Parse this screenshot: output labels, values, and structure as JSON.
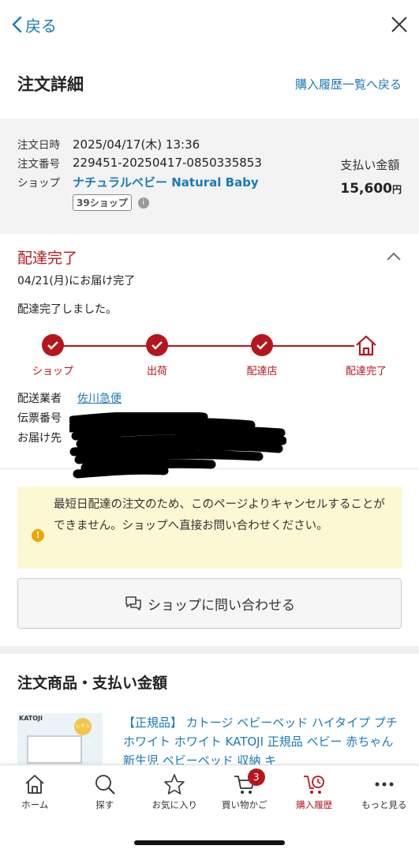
{
  "nav": {
    "back_label": "戻る"
  },
  "header": {
    "title": "注文詳細",
    "history_link": "購入履歴一覧へ戻る"
  },
  "order": {
    "date_label": "注文日時",
    "date_value": "2025/04/17(木) 13:36",
    "number_label": "注文番号",
    "number_value": "229451-20250417-0850335853",
    "shop_label": "ショップ",
    "shop_value": "ナチュラルベビー Natural Baby",
    "badge": "39ショップ",
    "info_icon": "i",
    "pay_label": "支払い金額",
    "pay_value": "15,600",
    "pay_unit": "円"
  },
  "delivery": {
    "status": "配達完了",
    "date": "04/21(月)にお届け完了",
    "message": "配達完了しました。",
    "steps": [
      "ショップ",
      "出荷",
      "配達店",
      "配達完了"
    ],
    "carrier_label": "配送業者",
    "carrier_value": "佐川急便",
    "slip_label": "伝票番号",
    "address_label": "お届け先"
  },
  "notice": {
    "icon": "!",
    "text": "最短日配達の注文のため、このページよりキャンセルすることができません。ショップへ直接お問い合わせください。"
  },
  "contact_button": "ショップに問い合わせる",
  "products": {
    "heading": "注文商品・支払い金額",
    "thumb_brand": "KATOJI",
    "thumb_tag": "レギュラー サイズ",
    "item_title": "【正規品】 カトージ ベビーベッド ハイタイプ プチホワイト ホワイト KATOJI 正規品 ベビー 赤ちゃん 新生児 ベビーベッド 収納 キ"
  },
  "tabbar": {
    "items": [
      {
        "label": "ホーム",
        "icon": "home-icon"
      },
      {
        "label": "探す",
        "icon": "search-icon"
      },
      {
        "label": "お気に入り",
        "icon": "star-icon"
      },
      {
        "label": "買い物かご",
        "icon": "cart-icon",
        "badge": "3"
      },
      {
        "label": "購入履歴",
        "icon": "history-icon",
        "active": true
      },
      {
        "label": "もっと見る",
        "icon": "more-icon"
      }
    ]
  },
  "colors": {
    "accent": "#b5161e",
    "link": "#1a7bb8",
    "notice_bg": "#fcf8d4"
  }
}
